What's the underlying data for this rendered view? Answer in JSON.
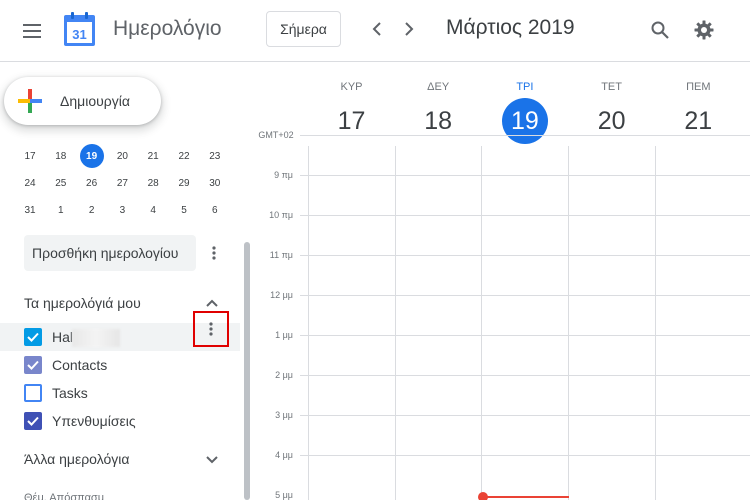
{
  "header": {
    "app_title": "Ημερολόγιο",
    "logo_day": "31",
    "today_label": "Σήμερα",
    "month_title": "Μάρτιος 2019"
  },
  "sidebar": {
    "create_label": "Δημιουργία",
    "mini_calendar": {
      "rows": [
        [
          "17",
          "18",
          "19",
          "20",
          "21",
          "22",
          "23"
        ],
        [
          "24",
          "25",
          "26",
          "27",
          "28",
          "29",
          "30"
        ],
        [
          "31",
          "1",
          "2",
          "3",
          "4",
          "5",
          "6"
        ]
      ],
      "today": "19"
    },
    "add_calendar_placeholder": "Προσθήκη ημερολογίου",
    "my_calendars_title": "Τα ημερολόγιά μου",
    "my_calendars": [
      {
        "name": "Hal",
        "color": "#039be5",
        "checked": true
      },
      {
        "name": "Contacts",
        "color": "#7986cb",
        "checked": true
      },
      {
        "name": "Tasks",
        "color": "#4285f4",
        "checked": false
      },
      {
        "name": "Υπενθυμίσεις",
        "color": "#3f51b5",
        "checked": true
      }
    ],
    "other_calendars_title": "Άλλα ημερολόγια",
    "other_partial_text": "Θέμ. Απόσπασμ"
  },
  "grid": {
    "timezone": "GMT+02",
    "days": [
      {
        "dow": "ΚΥΡ",
        "num": "17"
      },
      {
        "dow": "ΔΕΥ",
        "num": "18"
      },
      {
        "dow": "ΤΡΙ",
        "num": "19",
        "today": true
      },
      {
        "dow": "ΤΕΤ",
        "num": "20"
      },
      {
        "dow": "ΠΕΜ",
        "num": "21"
      }
    ],
    "hours": [
      "9 πμ",
      "10 πμ",
      "11 πμ",
      "12 μμ",
      "1 μμ",
      "2 μμ",
      "3 μμ",
      "4 μμ",
      "5 μμ"
    ]
  },
  "colors": {
    "accent": "#1a73e8",
    "now_indicator": "#ea4335",
    "highlight_box": "#e00000"
  }
}
